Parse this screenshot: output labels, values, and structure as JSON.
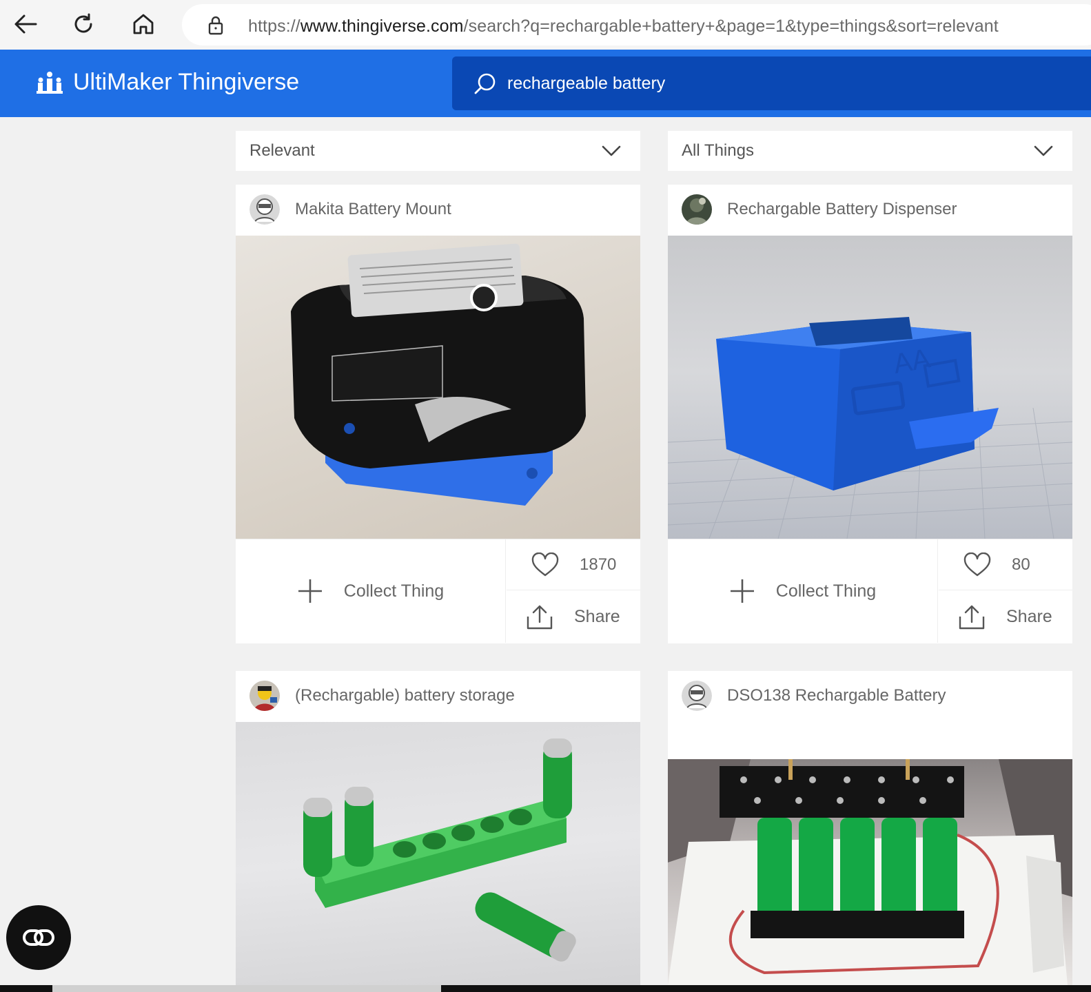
{
  "browser": {
    "url_prefix": "https://",
    "url_host": "www.thingiverse.com",
    "url_path": "/search?q=rechargable+battery+&page=1&type=things&sort=relevant"
  },
  "header": {
    "logo_text": "UltiMaker Thingiverse",
    "search_value": "rechargeable battery",
    "brand_color": "#1f6fe5",
    "search_bg": "#0a48b4"
  },
  "filters": {
    "sort_label": "Relevant",
    "type_label": "All Things"
  },
  "cards": [
    {
      "title": "Makita Battery Mount",
      "likes": "1870",
      "collect_label": "Collect Thing",
      "share_label": "Share"
    },
    {
      "title": "Rechargable Battery Dispenser",
      "likes": "80",
      "collect_label": "Collect Thing",
      "share_label": "Share"
    },
    {
      "title": "(Rechargable) battery storage"
    },
    {
      "title": "DSO138 Rechargable Battery"
    }
  ],
  "icons": [
    "back-arrow-icon",
    "refresh-icon",
    "home-icon",
    "lock-icon",
    "logo-mark-icon",
    "search-icon",
    "chevron-down-icon",
    "plus-icon",
    "heart-icon",
    "share-icon",
    "reader-mode-icon"
  ]
}
